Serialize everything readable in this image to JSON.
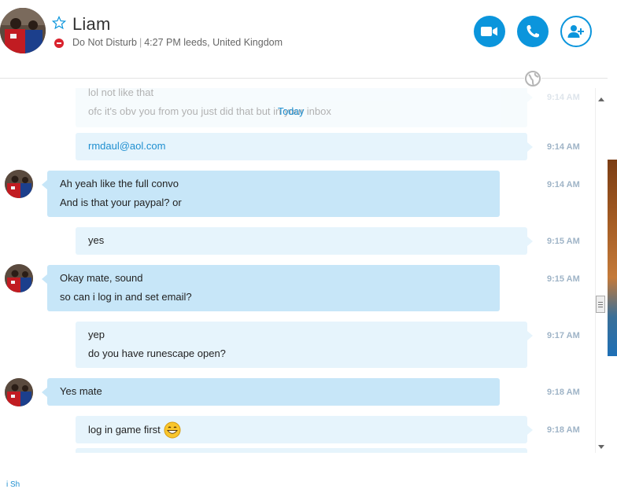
{
  "contact": {
    "name": "Liam",
    "presence": "Do Not Disturb",
    "local_time": "4:27 PM leeds, United Kingdom"
  },
  "header_buttons": {
    "video_icon": "video-camera-icon",
    "call_icon": "phone-icon",
    "add_icon": "add-person-icon"
  },
  "colors": {
    "accent": "#0b95dc",
    "my_bubble": "#e6f4fc",
    "their_bubble": "#c7e6f8",
    "dnd": "#d9232e"
  },
  "chat": {
    "date_separator": "Today",
    "faded_top_lines": [
      "lol not like that",
      "ofc it's obv you from you just did that but in your inbox"
    ],
    "faded_top_time": "9:14 AM",
    "messages": [
      {
        "sender": "me",
        "lines": [
          "rmdaul@aol.com"
        ],
        "time": "9:14 AM"
      },
      {
        "sender": "Liam",
        "lines": [
          "Ah yeah like the full convo",
          "And is that your paypal? or"
        ],
        "time": "9:14 AM"
      },
      {
        "sender": "me",
        "lines": [
          "yes"
        ],
        "time": "9:15 AM"
      },
      {
        "sender": "Liam",
        "lines": [
          "Okay mate, sound",
          "so can i log in and set email?"
        ],
        "time": "9:15 AM"
      },
      {
        "sender": "me",
        "lines": [
          "yep",
          "do you have runescape open?"
        ],
        "time": "9:17 AM"
      },
      {
        "sender": "Liam",
        "lines": [
          "Yes mate"
        ],
        "time": "9:18 AM"
      },
      {
        "sender": "me",
        "lines": [
          "log in game first"
        ],
        "time": "9:18 AM"
      }
    ]
  },
  "footer": {
    "partial_text": "i Sh"
  }
}
